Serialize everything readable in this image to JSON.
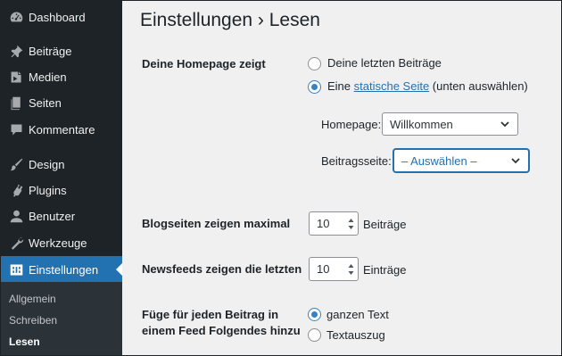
{
  "sidebar": {
    "items": [
      {
        "label": "Dashboard",
        "icon": "dashboard-icon"
      },
      {
        "label": "Beiträge",
        "icon": "pin-icon"
      },
      {
        "label": "Medien",
        "icon": "media-icon"
      },
      {
        "label": "Seiten",
        "icon": "pages-icon"
      },
      {
        "label": "Kommentare",
        "icon": "comment-icon"
      },
      {
        "label": "Design",
        "icon": "brush-icon"
      },
      {
        "label": "Plugins",
        "icon": "plugin-icon"
      },
      {
        "label": "Benutzer",
        "icon": "user-icon"
      },
      {
        "label": "Werkzeuge",
        "icon": "wrench-icon"
      },
      {
        "label": "Einstellungen",
        "icon": "settings-icon",
        "active": true
      }
    ],
    "submenu": [
      {
        "label": "Allgemein"
      },
      {
        "label": "Schreiben"
      },
      {
        "label": "Lesen",
        "current": true
      }
    ],
    "colors": {
      "background": "#1d2327",
      "active": "#2271b1",
      "submenu": "#2c3338"
    }
  },
  "main": {
    "title": "Einstellungen › Lesen",
    "homepage": {
      "label": "Deine Homepage zeigt",
      "option_latest": "Deine letzten Beiträge",
      "option_static_prefix": "Eine ",
      "option_static_link": "statische Seite",
      "option_static_suffix": " (unten auswählen)",
      "selected": "static",
      "homepage_label": "Homepage:",
      "homepage_value": "Willkommen",
      "postspage_label": "Beitragsseite:",
      "postspage_value": "– Auswählen –"
    },
    "blog_pages": {
      "label": "Blogseiten zeigen maximal",
      "value": "10",
      "unit": "Beiträge"
    },
    "feeds": {
      "label": "Newsfeeds zeigen die letzten",
      "value": "10",
      "unit": "Einträge"
    },
    "feed_content": {
      "label_line1": "Füge für jeden Beitrag in",
      "label_line2": "einem Feed Folgendes hinzu",
      "option_full": "ganzen Text",
      "option_excerpt": "Textauszug",
      "selected": "full"
    }
  }
}
